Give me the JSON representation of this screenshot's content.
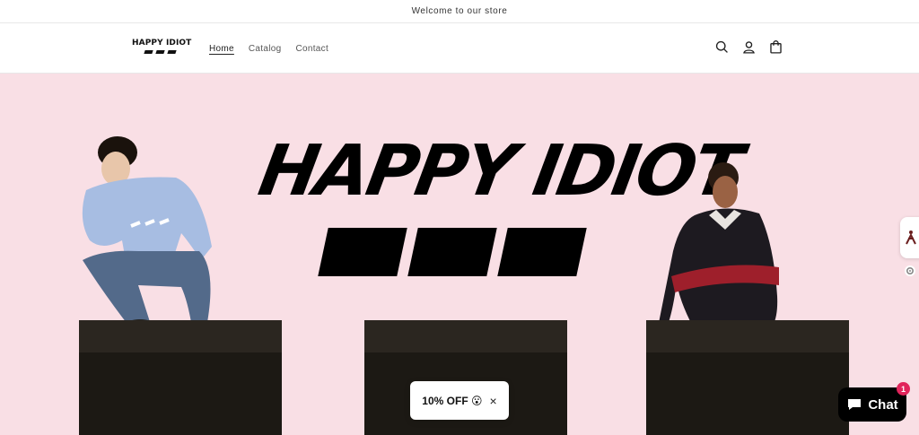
{
  "announcement": {
    "text": "Welcome to our store"
  },
  "header": {
    "logo_text": "HAPPY IDIOT",
    "nav": [
      {
        "label": "Home",
        "active": true
      },
      {
        "label": "Catalog",
        "active": false
      },
      {
        "label": "Contact",
        "active": false
      }
    ],
    "icons": [
      "search-icon",
      "account-icon",
      "cart-icon"
    ]
  },
  "hero": {
    "title": "HAPPY IDIOT",
    "background": "#f9dfe5"
  },
  "promo": {
    "label": "10% OFF 😮",
    "close": "×"
  },
  "chat": {
    "label": "Chat",
    "badge": "1"
  },
  "colors": {
    "hero_pink": "#f9dfe5",
    "chat_badge": "#e1245b",
    "box": "#1c1914"
  }
}
